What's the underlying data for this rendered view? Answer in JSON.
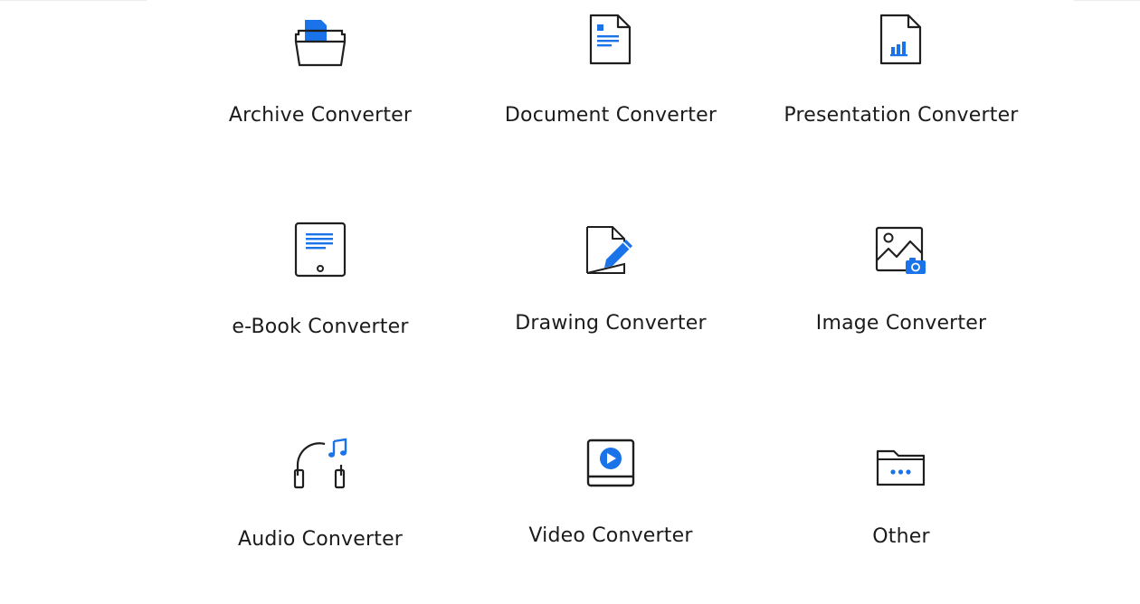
{
  "colors": {
    "accent": "#1a73e8",
    "stroke": "#1f1f1f",
    "text": "#1b1b1b"
  },
  "converters": [
    {
      "label": "Archive Converter",
      "icon": "archive-icon"
    },
    {
      "label": "Document Converter",
      "icon": "document-icon"
    },
    {
      "label": "Presentation Converter",
      "icon": "presentation-icon"
    },
    {
      "label": "e-Book Converter",
      "icon": "ebook-icon"
    },
    {
      "label": "Drawing Converter",
      "icon": "drawing-icon"
    },
    {
      "label": "Image Converter",
      "icon": "image-icon"
    },
    {
      "label": "Audio Converter",
      "icon": "audio-icon"
    },
    {
      "label": "Video Converter",
      "icon": "video-icon"
    },
    {
      "label": "Other",
      "icon": "folder-dots-icon"
    }
  ]
}
